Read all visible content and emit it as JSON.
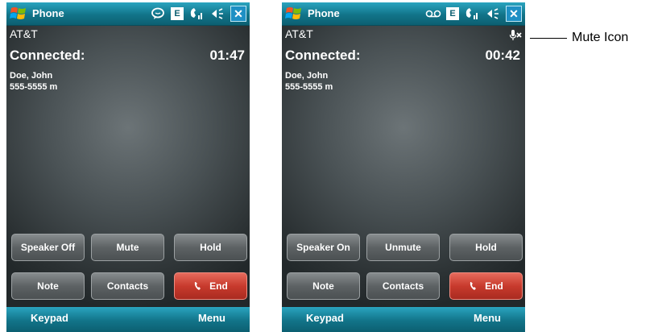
{
  "screens": [
    {
      "title": "Phone",
      "carrier": "AT&T",
      "status": "Connected:",
      "timer": "01:47",
      "contact_name": "Doe, John",
      "contact_number": "555-5555 m",
      "buttons": {
        "speaker": "Speaker Off",
        "mute": "Mute",
        "hold": "Hold",
        "note": "Note",
        "contacts": "Contacts",
        "end": "End"
      },
      "softkeys": {
        "left": "Keypad",
        "right": "Menu"
      },
      "tray_icons": [
        "chat-bubble-icon",
        "e-data-icon",
        "phone-signal-icon",
        "speaker-volume-icon",
        "close-icon"
      ],
      "close_label": "✕",
      "e_label": "E"
    },
    {
      "title": "Phone",
      "carrier": "AT&T",
      "status": "Connected:",
      "timer": "00:42",
      "contact_name": "Doe, John",
      "contact_number": "555-5555 m",
      "buttons": {
        "speaker": "Speaker On",
        "mute": "Unmute",
        "hold": "Hold",
        "note": "Note",
        "contacts": "Contacts",
        "end": "End"
      },
      "softkeys": {
        "left": "Keypad",
        "right": "Menu"
      },
      "tray_icons": [
        "voicemail-icon",
        "e-data-icon",
        "phone-signal-icon",
        "speaker-volume-icon",
        "close-icon"
      ],
      "close_label": "✕",
      "e_label": "E",
      "status_icon": "mute-icon"
    }
  ],
  "callout": {
    "label": "Mute Icon"
  },
  "colors": {
    "bar": "#127489",
    "end_button": "#c83a2d",
    "button": "#5d6264",
    "background": "#3b4244"
  }
}
